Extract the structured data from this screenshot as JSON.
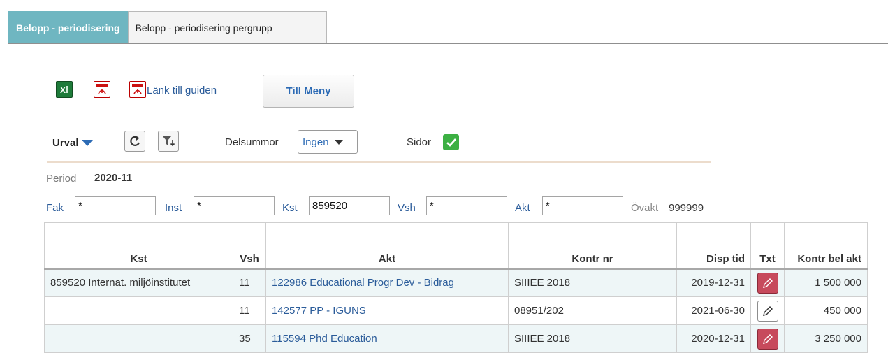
{
  "tabs": [
    {
      "label": "Belopp - periodisering",
      "active": true
    },
    {
      "label": "Belopp - periodisering pergrupp",
      "active": false
    }
  ],
  "toolbar": {
    "excel_icon": "excel-icon",
    "pdf_icon": "pdf-icon",
    "guide_link": "Länk till guiden",
    "menu_button": "Till Meny"
  },
  "controls": {
    "urval_label": "Urval",
    "delsummor_label": "Delsummor",
    "delsummor_value": "Ingen",
    "sidor_label": "Sidor",
    "sidor_checked": true
  },
  "period": {
    "label": "Period",
    "value": "2020-11"
  },
  "filters": {
    "fak": {
      "label": "Fak",
      "value": "*"
    },
    "inst": {
      "label": "Inst",
      "value": "*"
    },
    "kst": {
      "label": "Kst",
      "value": "859520"
    },
    "vsh": {
      "label": "Vsh",
      "value": "*"
    },
    "akt": {
      "label": "Akt",
      "value": "*"
    },
    "ovakt": {
      "label": "Övakt",
      "value": "999999"
    }
  },
  "table": {
    "headers": [
      "Kst",
      "Vsh",
      "Akt",
      "Kontr nr",
      "Disp tid",
      "Txt",
      "Kontr bel akt"
    ],
    "rows": [
      {
        "kst": "859520 Internat. miljöinstitutet",
        "vsh": "11",
        "akt": "122986 Educational Progr Dev - Bidrag",
        "kontr_nr": "SIIIEE 2018",
        "disp_tid": "2019-12-31",
        "txt": "red",
        "kontr_bel_akt": "1 500 000"
      },
      {
        "kst": "",
        "vsh": "11",
        "akt": "142577 PP - IGUNS",
        "kontr_nr": "08951/202",
        "disp_tid": "2021-06-30",
        "txt": "white",
        "kontr_bel_akt": "450 000"
      },
      {
        "kst": "",
        "vsh": "35",
        "akt": "115594 Phd Education",
        "kontr_nr": "SIIIEE 2018",
        "disp_tid": "2020-12-31",
        "txt": "red",
        "kontr_bel_akt": "3 250 000"
      }
    ]
  },
  "colors": {
    "active_tab": "#6fb6c1",
    "link": "#2b5c9a",
    "check": "#3cb043",
    "pen_red": "#c74a5c"
  }
}
